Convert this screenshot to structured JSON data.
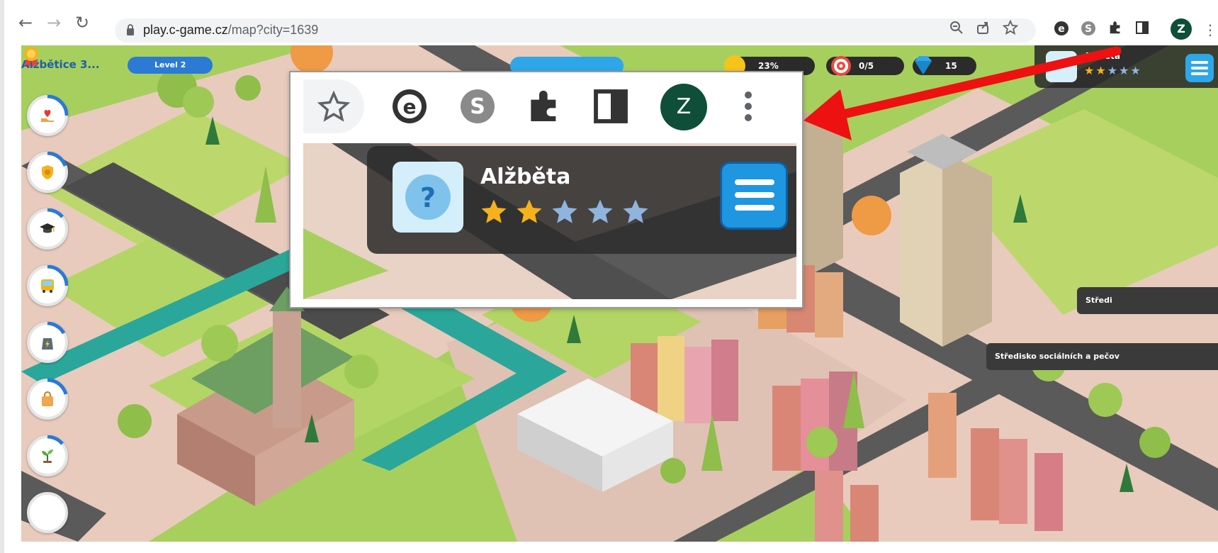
{
  "browser": {
    "url_host": "play.c-game.cz",
    "url_path": "/map?city=1639",
    "profile_initial": "Z"
  },
  "hud": {
    "city": "Alžbětice 3...",
    "level": "Level 2",
    "progress_1": "23%",
    "targets": "0/5",
    "gems": "15",
    "player_name_small": "Alžběta"
  },
  "zoom_callout": {
    "profile_initial": "Z",
    "player_name": "Alžběta",
    "help_glyph": "?",
    "stars_filled": 2,
    "stars_total": 5
  },
  "building_labels": {
    "label_1": "Středi",
    "label_2": "Středisko sociálních a pečov"
  },
  "colors": {
    "grass": "#a7cf5e",
    "road": "#5a5a5a",
    "sidewalk": "#e6cfc2",
    "water": "#2aa79a",
    "accent_blue": "#2ea7ea",
    "star_gold": "#f6b21b",
    "star_empty": "#8fb4de",
    "arrow_red": "#ee1111"
  },
  "icons": {
    "back": "arrow-left-icon",
    "forward": "arrow-right-icon",
    "reload": "reload-icon",
    "lock": "lock-icon",
    "zoom": "zoom-icon",
    "share": "share-icon",
    "bookmark": "star-icon",
    "extension_e": "e-extension-icon",
    "skype": "skype-icon",
    "puzzle": "puzzle-icon",
    "sidepanel": "side-panel-icon",
    "menu": "kebab-menu-icon"
  }
}
